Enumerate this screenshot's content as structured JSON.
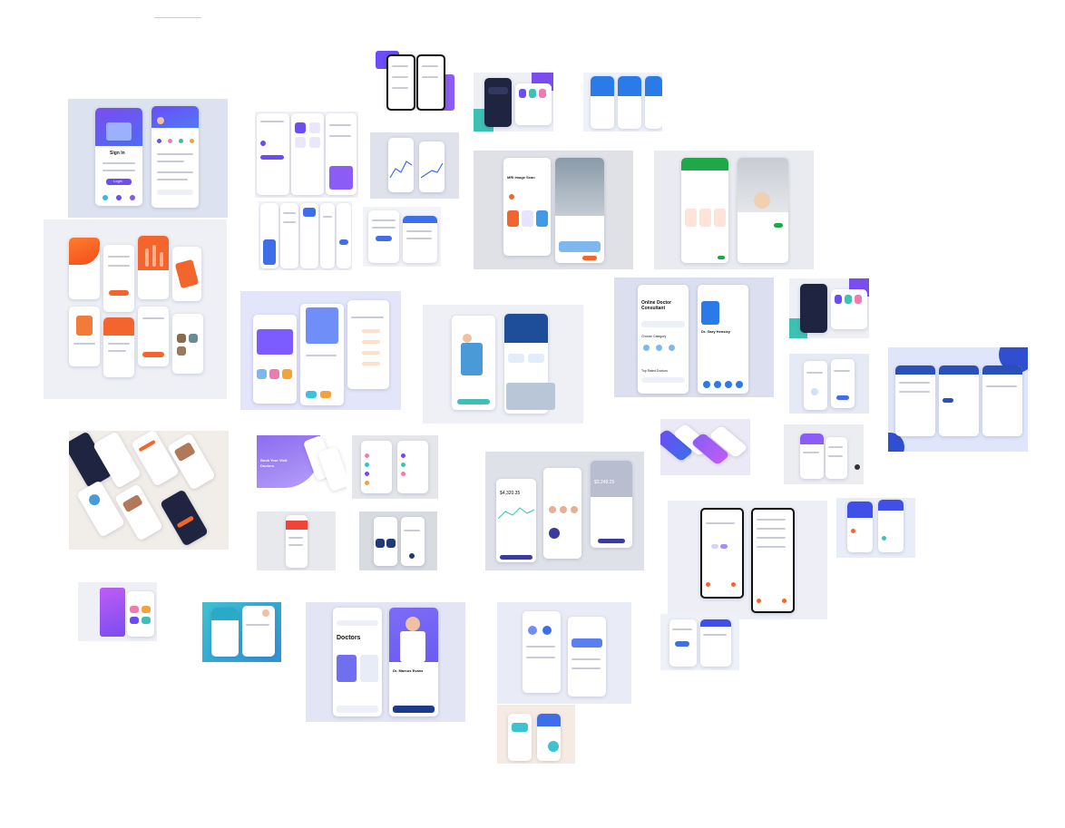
{
  "page": {
    "background": "#ffffff",
    "accent_purple": "#6b4cf6",
    "accent_blue": "#3f6fe8",
    "accent_orange": "#f4652e"
  },
  "tiles": [
    {
      "id": "signin",
      "texts": {
        "title": "Sign In",
        "button": "Login"
      }
    },
    {
      "id": "online-doctor",
      "texts": {
        "title": "Online Doctor Consultant",
        "section": "Choose Category",
        "list": "Top Rated Doctors",
        "name": "Dr. Gary Hensley"
      }
    },
    {
      "id": "doctors",
      "texts": {
        "title": "Doctors",
        "name": "Dr. Marcus Evans"
      }
    },
    {
      "id": "finance",
      "texts": {
        "balance": "$4,320.35",
        "balance2": "$3,248.25"
      }
    },
    {
      "id": "book-doctor",
      "texts": {
        "title": "Book Your Visit",
        "subtitle": "Doctors"
      }
    },
    {
      "id": "mri",
      "texts": {
        "title": "MRI image Scan"
      }
    }
  ]
}
